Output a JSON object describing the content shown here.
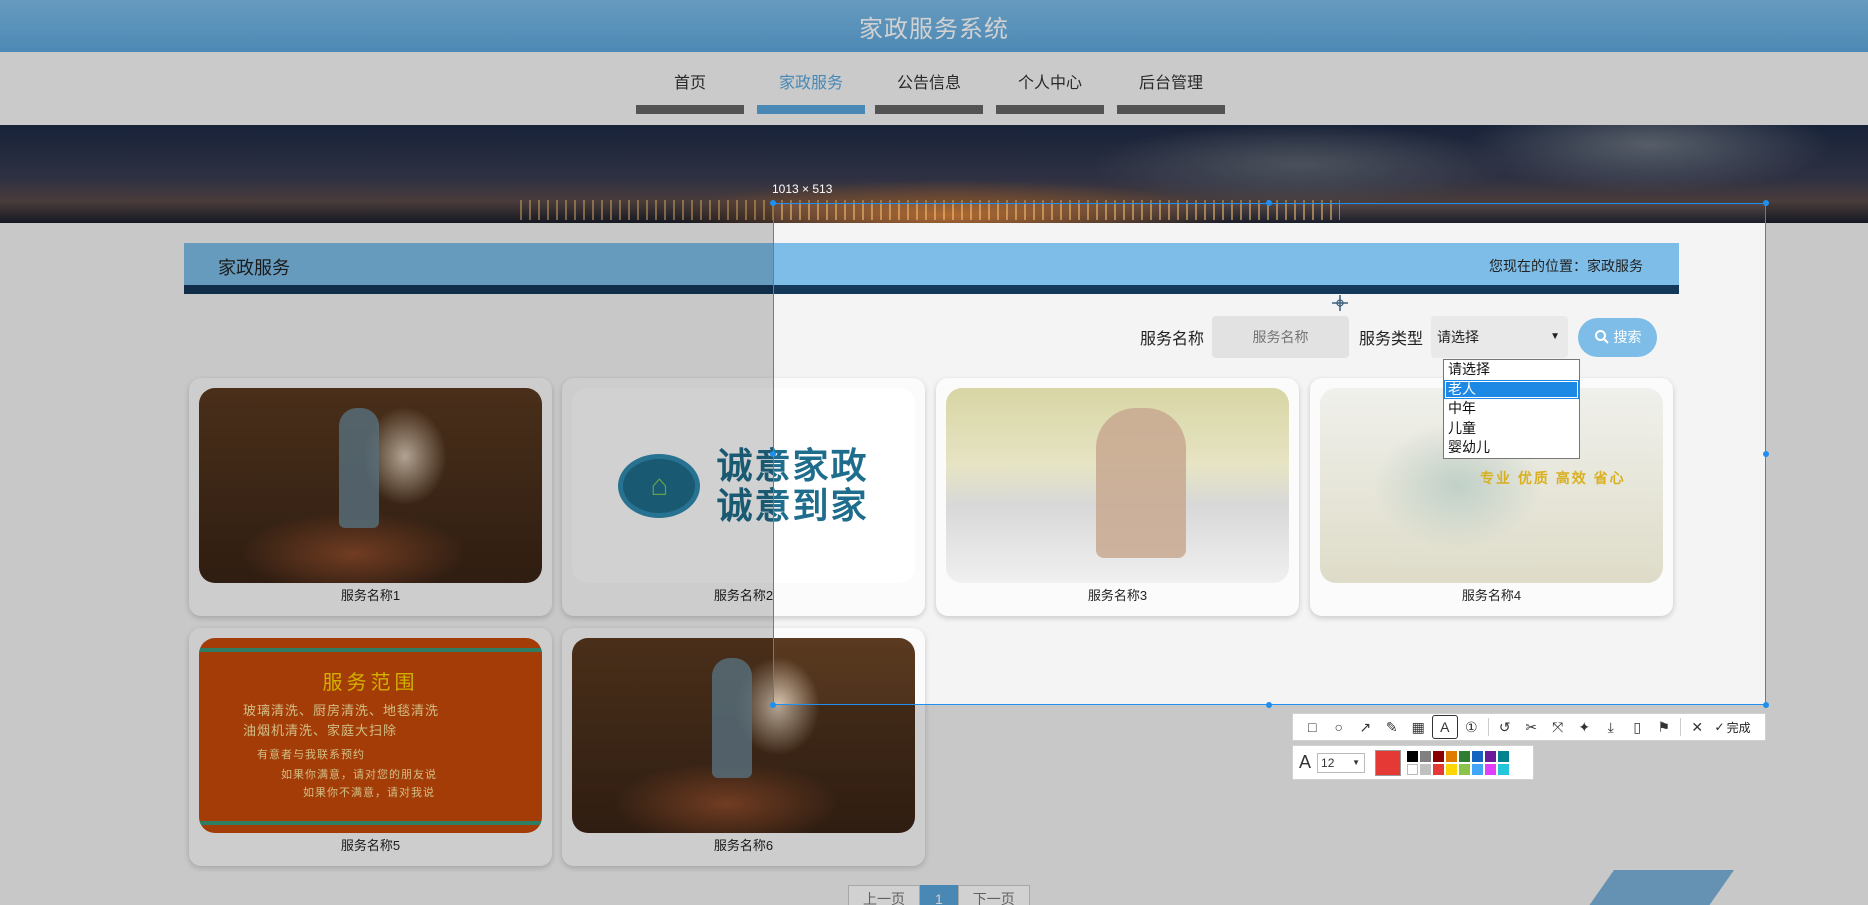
{
  "app_title": "家政服务系统",
  "nav": [
    {
      "label": "首页",
      "active": false
    },
    {
      "label": "家政服务",
      "active": true
    },
    {
      "label": "公告信息",
      "active": false
    },
    {
      "label": "个人中心",
      "active": false
    },
    {
      "label": "后台管理",
      "active": false
    }
  ],
  "panel": {
    "title": "家政服务",
    "location": "您现在的位置：家政服务"
  },
  "search": {
    "name_label": "服务名称",
    "name_placeholder": "服务名称",
    "type_label": "服务类型",
    "type_selected": "请选择",
    "button_label": "搜索",
    "type_options": [
      "请选择",
      "老人",
      "中年",
      "儿童",
      "婴幼儿"
    ],
    "highlighted_option": "老人"
  },
  "cards": [
    {
      "name": "服务名称1"
    },
    {
      "name": "服务名称2",
      "logo_line1": "诚意家政",
      "logo_line2": "诚意到家"
    },
    {
      "name": "服务名称3"
    },
    {
      "name": "服务名称4",
      "slogan": "专业 优质 高效 省心"
    },
    {
      "name": "服务名称5",
      "heading": "服务范围",
      "lines": [
        "玻璃清洗、厨房清洗、地毯清洗",
        "油烟机清洗、家庭大扫除",
        "有意者与我联系预约",
        "如果你满意，请对您的朋友说",
        "如果你不满意，请对我说"
      ]
    },
    {
      "name": "服务名称6"
    }
  ],
  "pager": {
    "prev": "上一页",
    "current": "1",
    "next": "下一页"
  },
  "screenshot_tool": {
    "dimensions": "1013 × 513",
    "done_label": "完成",
    "font_size": "12",
    "current_color": "#e53935",
    "palette": [
      "#000000",
      "#808080",
      "#8b0000",
      "#e07b00",
      "#2e7d32",
      "#1565c0",
      "#6a1b9a",
      "#00838f",
      "#ffffff",
      "#c0c0c0",
      "#e53935",
      "#ffd600",
      "#8bc34a",
      "#42a5f5",
      "#e040fb",
      "#26c6da"
    ],
    "tools": [
      "rect-icon",
      "circle-icon",
      "arrow-icon",
      "pencil-icon",
      "mosaic-icon",
      "text-icon",
      "number-icon",
      "undo-icon",
      "scissors-icon",
      "magic-icon",
      "pin-icon",
      "download-icon",
      "phone-icon",
      "bookmark-icon",
      "close-icon"
    ]
  }
}
